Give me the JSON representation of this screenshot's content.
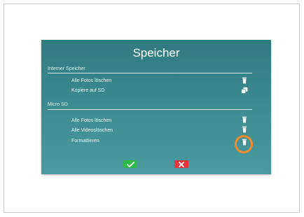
{
  "dialog": {
    "title": "Speicher",
    "sections": [
      {
        "label": "Interner Speicher",
        "items": [
          {
            "label": "Alle Fotos löschen",
            "icon": "trash-icon"
          },
          {
            "label": "Kopiere auf SD",
            "icon": "copy-icon"
          }
        ]
      },
      {
        "label": "Micro SD",
        "items": [
          {
            "label": "Alle Fotos löschen",
            "icon": "trash-icon"
          },
          {
            "label": "Alle Videoslöschen",
            "icon": "trash-icon"
          },
          {
            "label": "Formattieren",
            "icon": "trash-icon"
          }
        ]
      }
    ],
    "confirm_icon": "check-icon",
    "cancel_icon": "x-icon"
  },
  "colors": {
    "panel": "#3a8a8f",
    "highlight": "#f08a2c",
    "confirm": "#2fb84a",
    "cancel": "#e8343a"
  }
}
